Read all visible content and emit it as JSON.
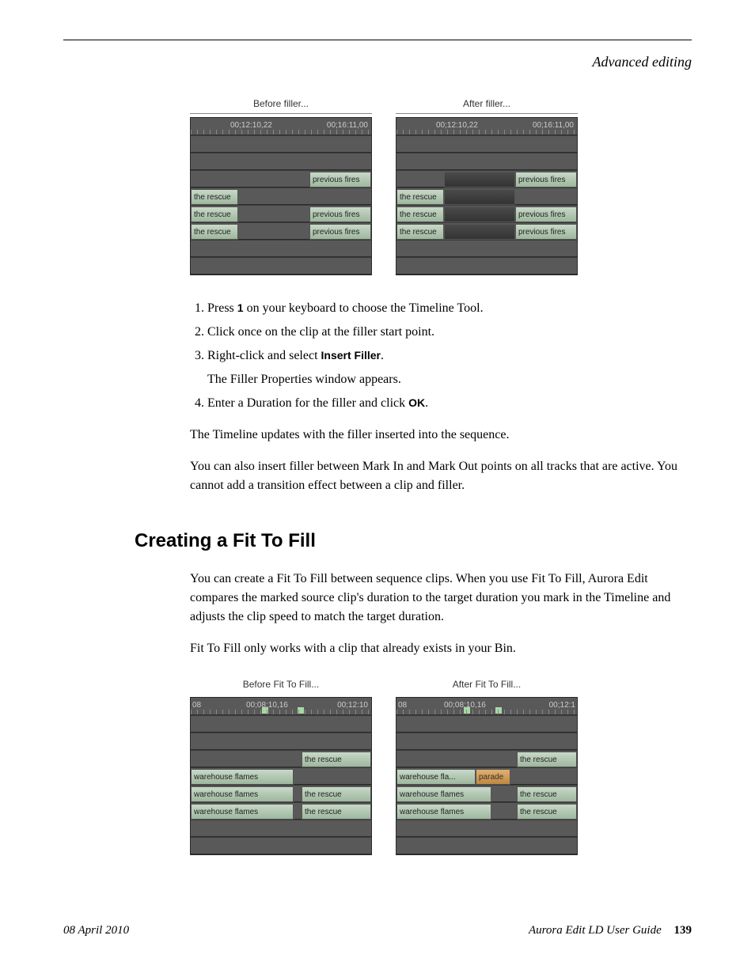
{
  "header": {
    "section_title": "Advanced editing"
  },
  "fig1": {
    "before_caption": "Before filler...",
    "after_caption": "After filler...",
    "tc1": "00;12:10,22",
    "tc2": "00;16:11,00",
    "clip_rescue": "the rescue",
    "clip_prev": "previous fires"
  },
  "steps": [
    {
      "pre": "Press ",
      "ui": "1",
      "post": " on your keyboard to choose the Timeline Tool."
    },
    {
      "pre": "Click once on the clip at the filler start point.",
      "ui": "",
      "post": ""
    },
    {
      "pre": "Right-click and select ",
      "ui": "Insert Filler",
      "post": ".",
      "sub": "The Filler Properties window appears."
    },
    {
      "pre": "Enter a Duration for the filler and click ",
      "ui": "OK",
      "post": "."
    }
  ],
  "paras": {
    "p1": "The Timeline updates with the filler inserted into the sequence.",
    "p2": "You can also insert filler between Mark In and Mark Out points on all tracks that are active. You cannot add a transition effect between a clip and filler."
  },
  "section2": {
    "heading": "Creating a Fit To Fill",
    "p1": "You can create a Fit To Fill between sequence clips. When you use Fit To Fill, Aurora Edit compares the marked source clip's duration to the target duration you mark in the Timeline and adjusts the clip speed to match the target duration.",
    "p2": "Fit To Fill only works with a clip that already exists in your Bin."
  },
  "fig2": {
    "before_caption": "Before Fit To Fill...",
    "after_caption": "After Fit To Fill...",
    "tc_left": "08",
    "tc1": "00;08:10,16",
    "tc2": "00;12:10",
    "tc2b": "00;12:1",
    "clip_wh": "warehouse flames",
    "clip_wh_short": "warehouse fla...",
    "clip_rescue": "the rescue",
    "clip_parade": "parade"
  },
  "footer": {
    "date": "08 April 2010",
    "guide": "Aurora Edit LD User Guide",
    "page": "139"
  }
}
